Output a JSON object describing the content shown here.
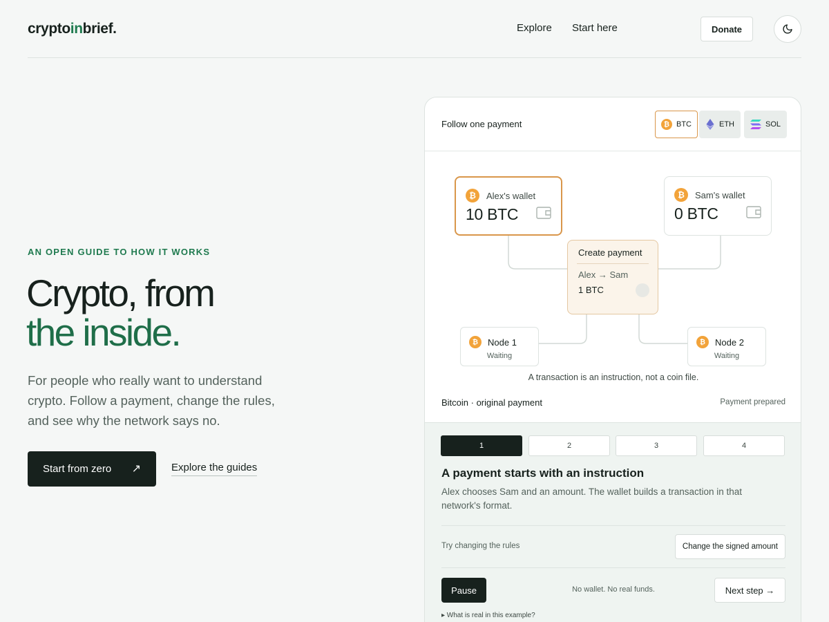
{
  "header": {
    "logo": {
      "part1": "crypto",
      "part2": "in",
      "part3": "brief."
    },
    "nav": [
      {
        "label": "Explore"
      },
      {
        "label": "Start here"
      }
    ],
    "donate_label": "Donate",
    "theme_icon": "moon-icon"
  },
  "hero": {
    "eyebrow": "AN OPEN GUIDE TO HOW IT WORKS",
    "title_line1": "Crypto, from",
    "title_line2": "the inside.",
    "subtitle": "For people who really want to understand crypto. Follow a payment, change the rules, and see why the network says no.",
    "primary_cta": "Start from zero",
    "primary_cta_arrow": "↗",
    "secondary_cta": "Explore the guides"
  },
  "card": {
    "title": "Follow one payment",
    "networks": [
      {
        "label": "BTC",
        "icon": "bitcoin-icon",
        "active": true
      },
      {
        "label": "ETH",
        "icon": "ethereum-icon",
        "active": false
      },
      {
        "label": "SOL",
        "icon": "solana-icon",
        "active": false
      }
    ],
    "wallets": [
      {
        "name": "Alex's wallet",
        "amount": "10 BTC",
        "active": true
      },
      {
        "name": "Sam's wallet",
        "amount": "0 BTC",
        "active": false
      }
    ],
    "create": {
      "title": "Create payment",
      "route": "Alex → Sam",
      "amount": "1 BTC"
    },
    "nodes": [
      {
        "name": "Node 1",
        "status": "Waiting"
      },
      {
        "name": "Node 2",
        "status": "Waiting"
      }
    ],
    "caption": "A transaction is an instruction, not a coin file.",
    "meta_left": "Bitcoin · original payment",
    "meta_right": "Payment prepared",
    "steps": [
      "1",
      "2",
      "3",
      "4"
    ],
    "active_step": 1,
    "step_title": "A payment starts with an instruction",
    "step_desc": "Alex chooses Sam and an amount. The wallet builds a transaction in that network's format.",
    "try_label": "Try changing the rules",
    "change_label": "Change the signed amount",
    "pause_label": "Pause",
    "funds_note": "No wallet. No real funds.",
    "next_label": "Next step →",
    "details_label": "▸  What is real in this example?"
  },
  "colors": {
    "accent": "#1f7a4f",
    "bitcoin": "#f2a33a",
    "dark": "#17211d"
  }
}
